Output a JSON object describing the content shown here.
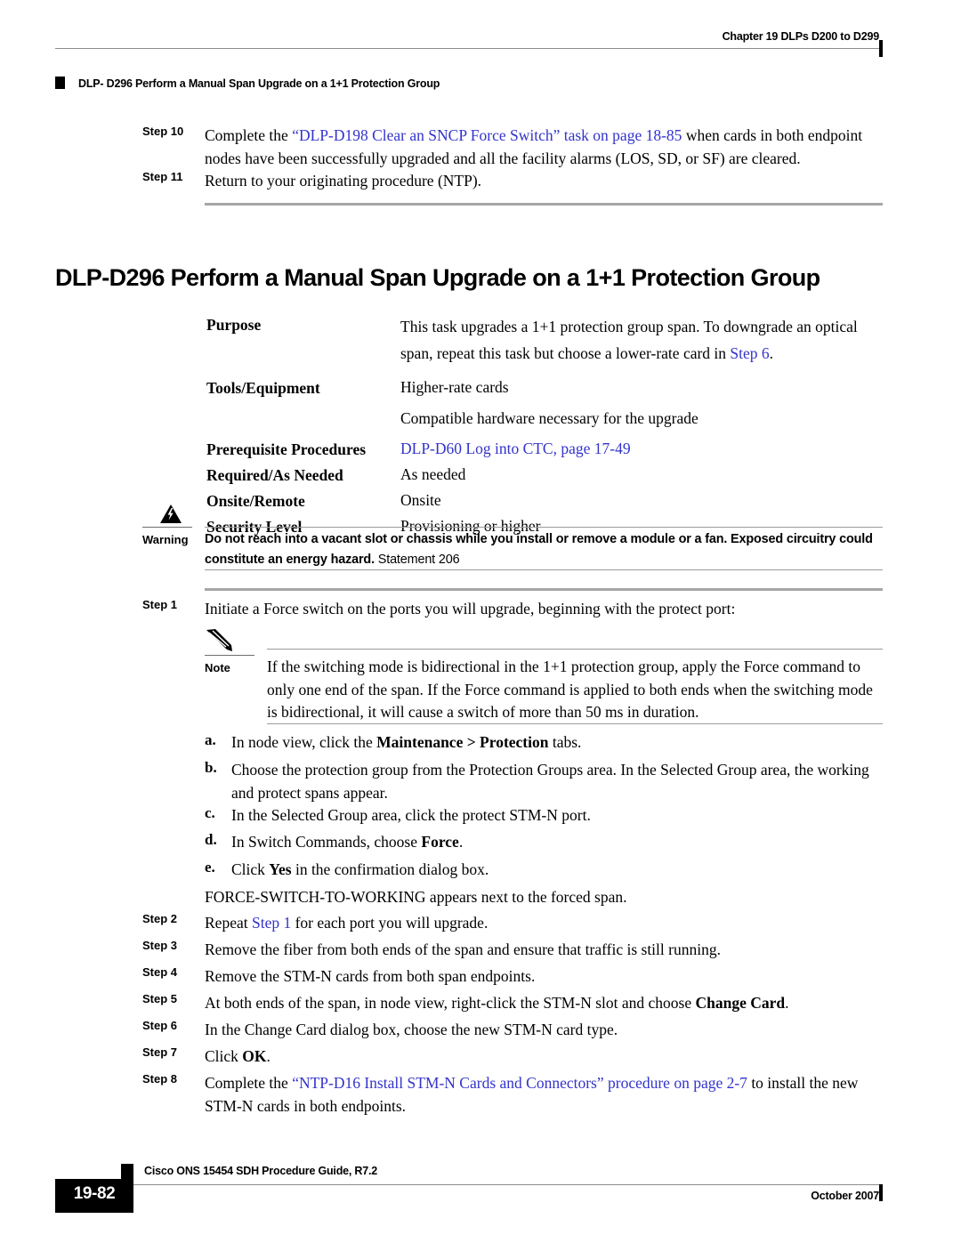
{
  "header": {
    "chapter": "Chapter 19 DLPs D200 to D299",
    "running_title": "DLP- D296 Perform a Manual Span Upgrade on a 1+1 Protection Group"
  },
  "top_steps": [
    {
      "label": "Step 10",
      "pre": "Complete the ",
      "link": "“DLP-D198 Clear an SNCP Force Switch” task on page 18-85",
      "post": " when cards in both endpoint nodes have been successfully upgraded and all the facility alarms (LOS, SD, or SF) are cleared."
    },
    {
      "label": "Step 11",
      "pre": "Return to your originating procedure (NTP).",
      "link": "",
      "post": ""
    }
  ],
  "section": {
    "title": "DLP-D296 Perform a Manual Span Upgrade on a 1+1 Protection Group"
  },
  "properties": [
    {
      "key": "Purpose",
      "value_pre": "This task upgrades a 1+1 protection group span. To downgrade an optical span, repeat this task but choose a lower-rate card in ",
      "value_link": "Step 6",
      "value_post": "."
    },
    {
      "key": "Tools/Equipment",
      "value_pre": "Higher-rate cards",
      "value_link": "",
      "value_post": ""
    },
    {
      "key": "",
      "value_pre": "Compatible hardware necessary for the upgrade",
      "value_link": "",
      "value_post": ""
    },
    {
      "key": "Prerequisite Procedures",
      "value_pre": "",
      "value_link": "DLP-D60 Log into CTC, page 17-49",
      "value_post": ""
    },
    {
      "key": "Required/As Needed",
      "value_pre": "As needed",
      "value_link": "",
      "value_post": ""
    },
    {
      "key": "Onsite/Remote",
      "value_pre": "Onsite",
      "value_link": "",
      "value_post": ""
    },
    {
      "key": "Security Level",
      "value_pre": "Provisioning or higher",
      "value_link": "",
      "value_post": ""
    }
  ],
  "warning": {
    "label": "Warning",
    "icon": "warning-triangle-icon",
    "text_bold": "Do not reach into a vacant slot or chassis while you install or remove a module or a fan. Exposed circuitry could constitute an energy hazard.",
    "text_statement": " Statement 206"
  },
  "step1": {
    "label": "Step 1",
    "text": "Initiate a Force switch on the ports you will upgrade, beginning with the protect port:"
  },
  "note": {
    "label": "Note",
    "icon": "pencil-note-icon",
    "text": "If the switching mode is bidirectional in the 1+1 protection group, apply the Force command to only one end of the span. If the Force command is applied to both ends when the switching mode is bidirectional, it will cause a switch of more than 50 ms in duration."
  },
  "substeps": [
    {
      "letter": "a.",
      "pre": "In node view, click the ",
      "bold1": "Maintenance > Protection",
      "post": " tabs."
    },
    {
      "letter": "b.",
      "pre": "Choose the protection group from the Protection Groups area. In the Selected Group area, the working and protect spans appear.",
      "bold1": "",
      "post": ""
    },
    {
      "letter": "c.",
      "pre": "In the Selected Group area, click the protect STM-N port.",
      "bold1": "",
      "post": ""
    },
    {
      "letter": "d.",
      "pre": "In Switch Commands, choose ",
      "bold1": "Force",
      "post": "."
    },
    {
      "letter": "e.",
      "pre": "Click ",
      "bold1": "Yes",
      "post": " in the confirmation dialog box."
    }
  ],
  "substeps_result": "FORCE-SWITCH-TO-WORKING appears next to the forced span.",
  "bottom_steps": [
    {
      "label": "Step 2",
      "pre": "Repeat ",
      "link": "Step 1",
      "post": " for each port you will upgrade.",
      "bold_tail": ""
    },
    {
      "label": "Step 3",
      "pre": "Remove the fiber from both ends of the span and ensure that traffic is still running.",
      "link": "",
      "post": "",
      "bold_tail": ""
    },
    {
      "label": "Step 4",
      "pre": "Remove the STM-N cards from both span endpoints.",
      "link": "",
      "post": "",
      "bold_tail": ""
    },
    {
      "label": "Step 5",
      "pre": "At both ends of the span, in node view, right-click the STM-N slot and choose ",
      "link": "",
      "post": ".",
      "bold_tail": "Change Card"
    },
    {
      "label": "Step 6",
      "pre": "In the Change Card dialog box, choose the new STM-N card type.",
      "link": "",
      "post": "",
      "bold_tail": ""
    },
    {
      "label": "Step 7",
      "pre": "Click ",
      "link": "",
      "post": ".",
      "bold_tail": "OK"
    },
    {
      "label": "Step 8",
      "pre": "Complete the ",
      "link": "“NTP-D16 Install STM-N Cards and Connectors” procedure on page 2-7",
      "post": " to install the new STM-N cards in both endpoints.",
      "bold_tail": ""
    }
  ],
  "footer": {
    "guide_title": "Cisco ONS 15454 SDH Procedure Guide, R7.2",
    "page_number": "19-82",
    "date": "October 2007"
  },
  "colors": {
    "link": "#3333cc",
    "rule_thick": "#a6a6a6",
    "rule_thin": "#9b9b9b",
    "text": "#000000"
  }
}
